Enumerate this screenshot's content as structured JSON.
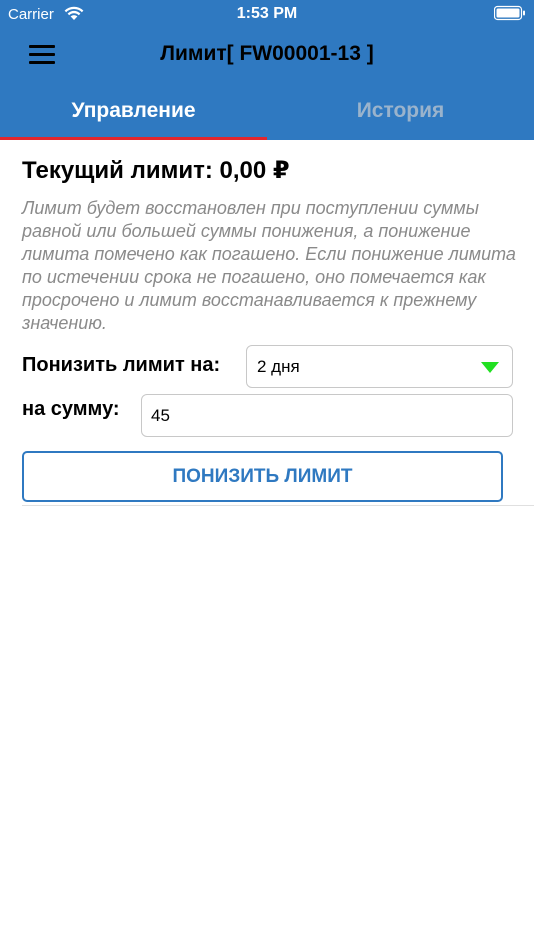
{
  "status_bar": {
    "carrier": "Carrier",
    "time": "1:53 PM"
  },
  "nav": {
    "title": "Лимит[ FW00001-13 ]",
    "menu_icon": "hamburger-menu-icon"
  },
  "tabs": [
    {
      "label": "Управление",
      "active": true
    },
    {
      "label": "История",
      "active": false
    }
  ],
  "limit": {
    "current_label": "Текущий лимит:",
    "current_value": "0,00 ₽",
    "description": "Лимит будет восстановлен при поступлении суммы равной или большей суммы понижения, а понижение лимита помечено как погашено. Если понижение лимита по истечении срока не погашено, оно помечается как просрочено и лимит восстанавливается к прежнему значению."
  },
  "form": {
    "reduce_label": "Понизить лимит на:",
    "period_value": "2 дня",
    "sum_label": "на сумму:",
    "sum_value": "45",
    "submit_label": "ПОНИЗИТЬ ЛИМИТ"
  },
  "colors": {
    "header_bg": "#2f79c1",
    "tab_indicator": "#e2262d",
    "dropdown_arrow": "#22e022",
    "button_accent": "#2f79c1",
    "description_text": "#8a8a8a"
  }
}
